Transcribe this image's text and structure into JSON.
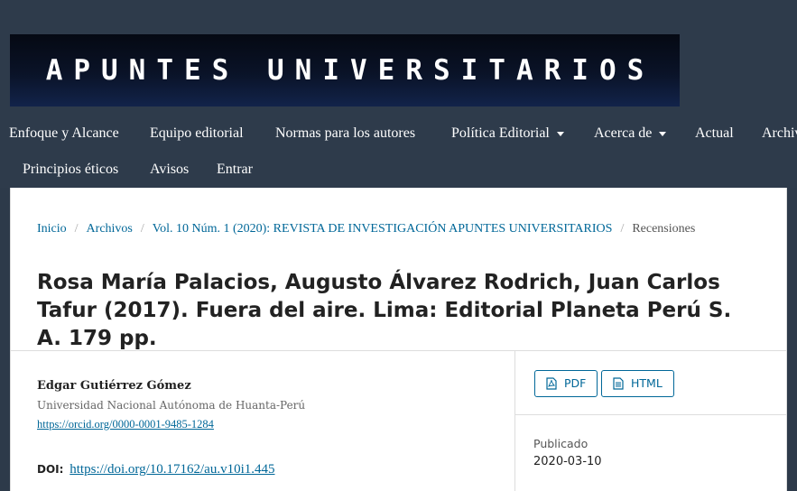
{
  "banner": {
    "title": "APUNTES UNIVERSITARIOS"
  },
  "nav": {
    "row1": [
      {
        "label": "Enfoque y Alcance",
        "dropdown": false
      },
      {
        "label": "Equipo editorial",
        "dropdown": false
      },
      {
        "label": "Normas para los autores",
        "dropdown": false
      },
      {
        "label": "Política Editorial",
        "dropdown": true
      },
      {
        "label": "Acerca de",
        "dropdown": true
      },
      {
        "label": "Actual",
        "dropdown": false
      },
      {
        "label": "Archivos",
        "dropdown": false
      }
    ],
    "row2": [
      {
        "label": "Principios éticos"
      },
      {
        "label": "Avisos"
      },
      {
        "label": "Entrar"
      }
    ]
  },
  "breadcrumb": {
    "home": "Inicio",
    "archives": "Archivos",
    "issue": "Vol. 10 Núm. 1 (2020): REVISTA DE INVESTIGACIÓN APUNTES UNIVERSITARIOS",
    "current": "Recensiones",
    "separator": "/"
  },
  "article": {
    "title": "Rosa María Palacios, Augusto Álvarez Rodrich, Juan Carlos Tafur (2017). Fuera del aire. Lima: Editorial Planeta Perú S. A. 179 pp.",
    "author": "Edgar Gutiérrez Gómez",
    "affiliation": "Universidad Nacional Autónoma de Huanta-Perú",
    "orcid": "https://orcid.org/0000-0001-9485-1284",
    "doi_label": "DOI:",
    "doi": "https://doi.org/10.17162/au.v10i1.445"
  },
  "galleys": {
    "pdf": "PDF",
    "html": "HTML"
  },
  "published": {
    "label": "Publicado",
    "date": "2020-03-10"
  },
  "colors": {
    "header_bg": "#2e3b4b",
    "link": "#006798"
  },
  "icons": {
    "pdf": "file-pdf-icon",
    "html": "file-text-icon",
    "dropdown": "caret-down-icon"
  }
}
